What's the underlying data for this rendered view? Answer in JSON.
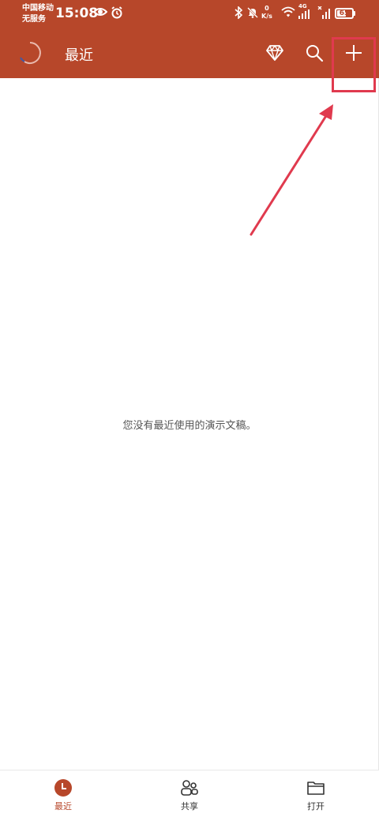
{
  "status_bar": {
    "carrier_line1": "中国移动",
    "carrier_line2": "无服务",
    "time": "15:08",
    "net_speed_value": "0",
    "net_speed_unit": "K/s",
    "network_type": "4G",
    "battery_level": 65,
    "battery_text": "65"
  },
  "app_bar": {
    "title": "最近",
    "icons": [
      "diamond-icon",
      "search-icon",
      "plus-icon"
    ]
  },
  "main": {
    "empty_message": "您没有最近使用的演示文稿。"
  },
  "bottom_nav": {
    "items": [
      {
        "label": "最近",
        "icon": "clock-icon",
        "active": true
      },
      {
        "label": "共享",
        "icon": "people-icon",
        "active": false
      },
      {
        "label": "打开",
        "icon": "folder-icon",
        "active": false
      }
    ]
  },
  "colors": {
    "brand": "#b7472a",
    "annotation": "#e03a4e",
    "text_muted": "#555555"
  }
}
